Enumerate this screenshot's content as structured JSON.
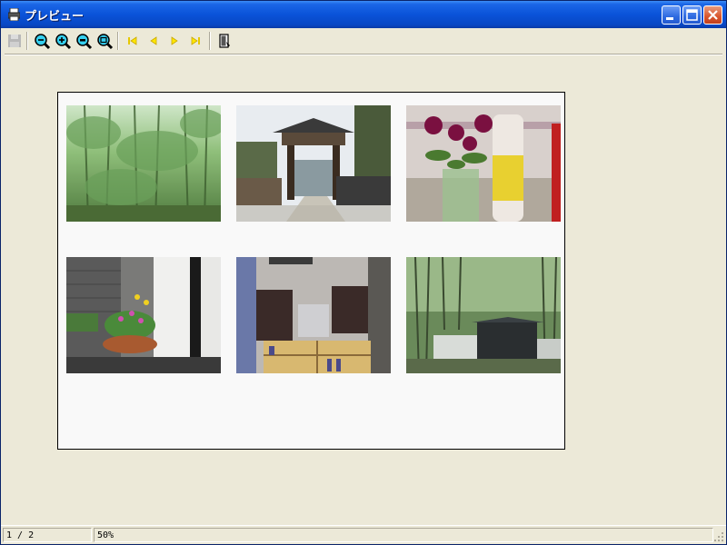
{
  "window": {
    "title": "プレビュー"
  },
  "toolbar": {
    "buttons": [
      {
        "name": "save-button",
        "icon": "floppy-disk-icon",
        "enabled": false
      },
      {
        "name": "zoom-out-button",
        "icon": "zoom-out-icon"
      },
      {
        "name": "zoom-in-button",
        "icon": "zoom-in-icon"
      },
      {
        "name": "zoom-out-alt-button",
        "icon": "zoom-out-icon"
      },
      {
        "name": "zoom-fit-button",
        "icon": "zoom-fit-icon"
      },
      {
        "name": "first-page-button",
        "icon": "first-page-icon"
      },
      {
        "name": "prev-page-button",
        "icon": "prev-page-icon"
      },
      {
        "name": "next-page-button",
        "icon": "next-page-icon"
      },
      {
        "name": "last-page-button",
        "icon": "last-page-icon"
      },
      {
        "name": "exit-button",
        "icon": "exit-door-icon"
      }
    ]
  },
  "preview": {
    "photos": [
      {
        "name": "bamboo-forest",
        "icon": "photo-bamboo-forest"
      },
      {
        "name": "temple-gate",
        "icon": "photo-temple-gate"
      },
      {
        "name": "flowers-and-diet-coke",
        "icon": "photo-flowers-bottle"
      },
      {
        "name": "balcony-planter",
        "icon": "photo-balcony-planter"
      },
      {
        "name": "speakers-shelf",
        "icon": "photo-speakers-shelf"
      },
      {
        "name": "bamboo-wall-gate",
        "icon": "photo-bamboo-wall-gate"
      }
    ]
  },
  "status": {
    "page": "1 / 2",
    "zoom": "50%"
  },
  "colors": {
    "titlebar": "#0a53d9",
    "chrome": "#ece9d8",
    "page": "#f9f9f9"
  }
}
